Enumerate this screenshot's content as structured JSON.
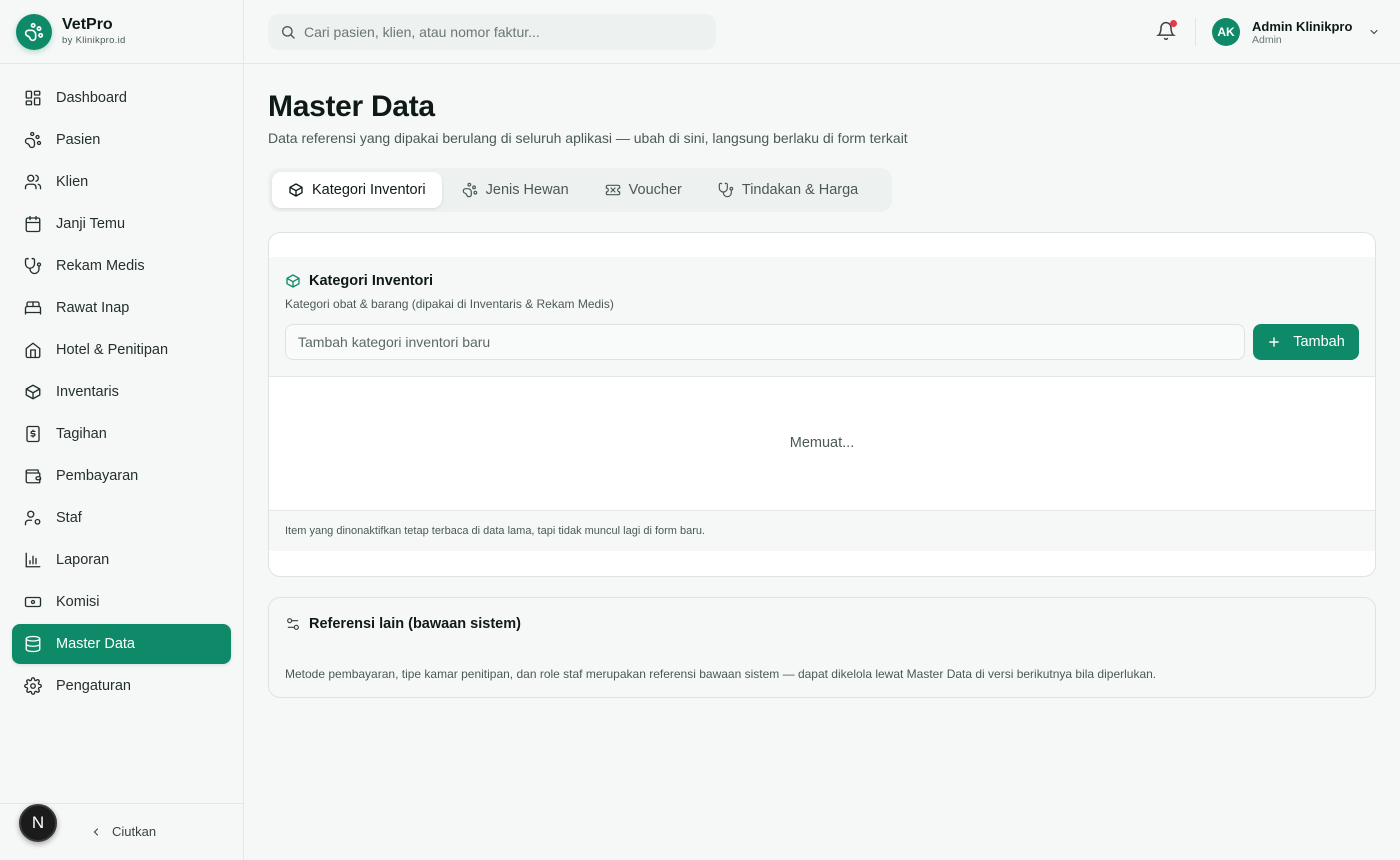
{
  "brand": {
    "name": "VetPro",
    "sub": "by Klinikpro.id"
  },
  "sidebar": {
    "items": [
      {
        "label": "Dashboard",
        "icon": "dashboard-icon",
        "active": false
      },
      {
        "label": "Pasien",
        "icon": "paw-icon",
        "active": false
      },
      {
        "label": "Klien",
        "icon": "users-icon",
        "active": false
      },
      {
        "label": "Janji Temu",
        "icon": "calendar-icon",
        "active": false
      },
      {
        "label": "Rekam Medis",
        "icon": "stethoscope-icon",
        "active": false
      },
      {
        "label": "Rawat Inap",
        "icon": "bed-icon",
        "active": false
      },
      {
        "label": "Hotel & Penitipan",
        "icon": "home-icon",
        "active": false
      },
      {
        "label": "Inventaris",
        "icon": "box-icon",
        "active": false
      },
      {
        "label": "Tagihan",
        "icon": "receipt-icon",
        "active": false
      },
      {
        "label": "Pembayaran",
        "icon": "wallet-icon",
        "active": false
      },
      {
        "label": "Staf",
        "icon": "user-cog-icon",
        "active": false
      },
      {
        "label": "Laporan",
        "icon": "bar-chart-icon",
        "active": false
      },
      {
        "label": "Komisi",
        "icon": "banknote-icon",
        "active": false
      },
      {
        "label": "Master Data",
        "icon": "database-icon",
        "active": true
      },
      {
        "label": "Pengaturan",
        "icon": "gear-icon",
        "active": false
      }
    ],
    "collapse_label": "Ciutkan",
    "badge_letter": "N"
  },
  "header": {
    "search_placeholder": "Cari pasien, klien, atau nomor faktur...",
    "user_initials": "AK",
    "user_name": "Admin Klinikpro",
    "user_role": "Admin"
  },
  "page": {
    "title": "Master Data",
    "subtitle": "Data referensi yang dipakai berulang di seluruh aplikasi — ubah di sini, langsung berlaku di form terkait"
  },
  "tabs": [
    {
      "label": "Kategori Inventori",
      "icon": "box-icon",
      "active": true
    },
    {
      "label": "Jenis Hewan",
      "icon": "paw-icon",
      "active": false
    },
    {
      "label": "Voucher",
      "icon": "ticket-icon",
      "active": false
    },
    {
      "label": "Tindakan & Harga",
      "icon": "stethoscope-icon",
      "active": false
    }
  ],
  "category_card": {
    "title": "Kategori Inventori",
    "description": "Kategori obat & barang (dipakai di Inventaris & Rekam Medis)",
    "input_placeholder": "Tambah kategori inventori baru",
    "add_button": "Tambah",
    "loading_text": "Memuat...",
    "footer_note": "Item yang dinonaktifkan tetap terbaca di data lama, tapi tidak muncul lagi di form baru."
  },
  "reference_card": {
    "title": "Referensi lain (bawaan sistem)",
    "description": "Metode pembayaran, tipe kamar penitipan, dan role staf merupakan referensi bawaan sistem — dapat dikelola lewat Master Data di versi berikutnya bila diperlukan."
  },
  "colors": {
    "accent": "#0f8a68",
    "notification": "#e23a4e"
  }
}
